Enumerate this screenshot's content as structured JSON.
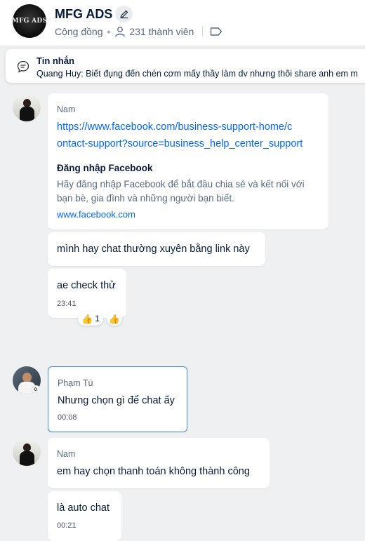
{
  "header": {
    "group_avatar_text": "MFG ADS",
    "group_name": "MFG ADS",
    "type_label": "Cộng đồng",
    "members_label": "231 thành viên"
  },
  "pinned": {
    "title": "Tin nhắn",
    "text": "Quang Huy: Biết đụng đến chén cơm mấy thầy làm dv nhưng thôi share anh em m"
  },
  "messages": [
    {
      "sender": "Nam",
      "link_line1": "https://www.facebook.com/business-support-home/c",
      "link_line2": "ontact-support?source=business_help_center_support",
      "preview_title": "Đăng nhập Facebook",
      "preview_desc_line1": "Hãy đăng nhập Facebook để bắt đầu chia sẻ và kết nối với",
      "preview_desc_line2": "bạn bè, gia đình và những người bạn biết.",
      "preview_domain": "www.facebook.com"
    },
    {
      "text": "mình hay chat thường xuyên bằng link này"
    },
    {
      "text": "ae check thử",
      "time": "23:41",
      "reaction_emoji": "👍",
      "reaction_count": "1",
      "react_button_emoji": "👍"
    },
    {
      "sender": "Phạm Tú",
      "text": "Nhưng chọn gì để chat ấy",
      "time": "00:08"
    },
    {
      "sender": "Nam",
      "text": "em hay chọn thanh toán không thành công"
    },
    {
      "text": "là auto chat",
      "time": "00:21"
    }
  ],
  "colors": {
    "accent": "#0068ff",
    "background": "#eef0f1",
    "selected_border": "#4a90e2"
  }
}
